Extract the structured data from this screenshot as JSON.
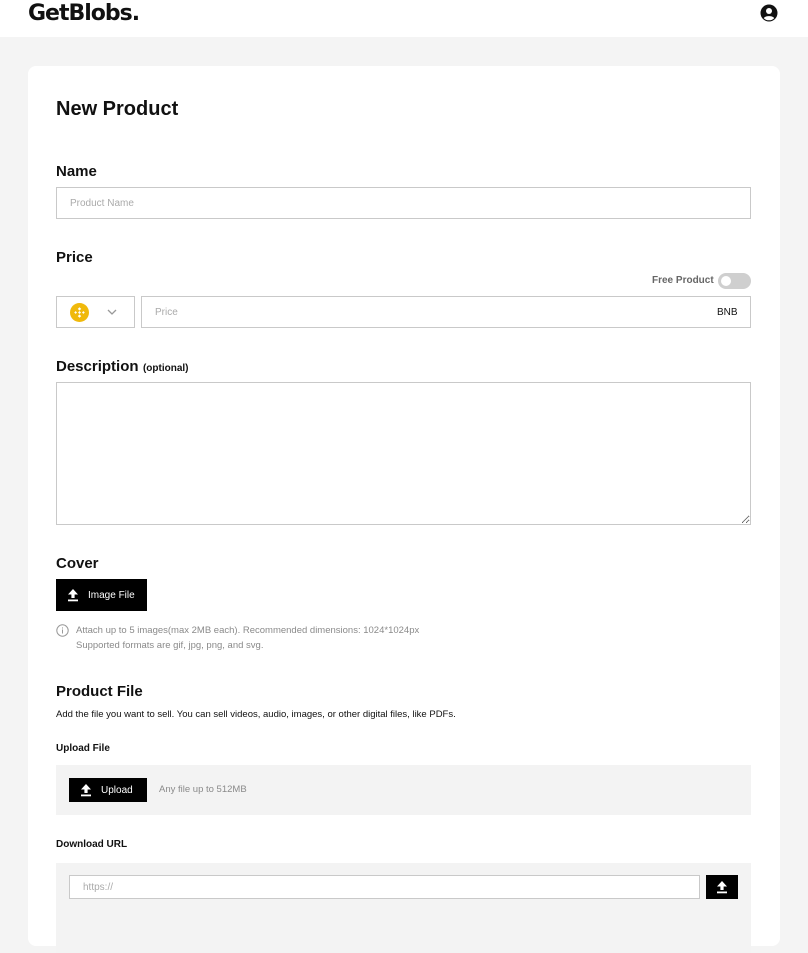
{
  "header": {
    "logo": "GetBlobs.",
    "user_icon": "user-circle-icon"
  },
  "form": {
    "title": "New Product",
    "name": {
      "label": "Name",
      "placeholder": "Product Name"
    },
    "price": {
      "label": "Price",
      "free_product_label": "Free Product",
      "free_product_on": false,
      "currency_icon": "bnb-coin-icon",
      "placeholder": "Price",
      "currency": "BNB"
    },
    "description": {
      "label": "Description",
      "optional": "(optional)"
    },
    "cover": {
      "label": "Cover",
      "button": "Image File",
      "hint_line1": "Attach up to 5 images(max 2MB each). Recommended dimensions: 1024*1024px",
      "hint_line2": "Supported formats are gif, jpg, png, and svg."
    },
    "product_file": {
      "label": "Product File",
      "description": "Add the file you want to sell. You can sell videos, audio, images, or other digital files, like PDFs.",
      "upload_label": "Upload File",
      "upload_button": "Upload",
      "upload_hint": "Any file up to 512MB",
      "download_label": "Download URL",
      "download_placeholder": "https://"
    }
  },
  "colors": {
    "accent": "#000000",
    "bnb": "#F0B90B",
    "background": "#f4f4f4"
  }
}
